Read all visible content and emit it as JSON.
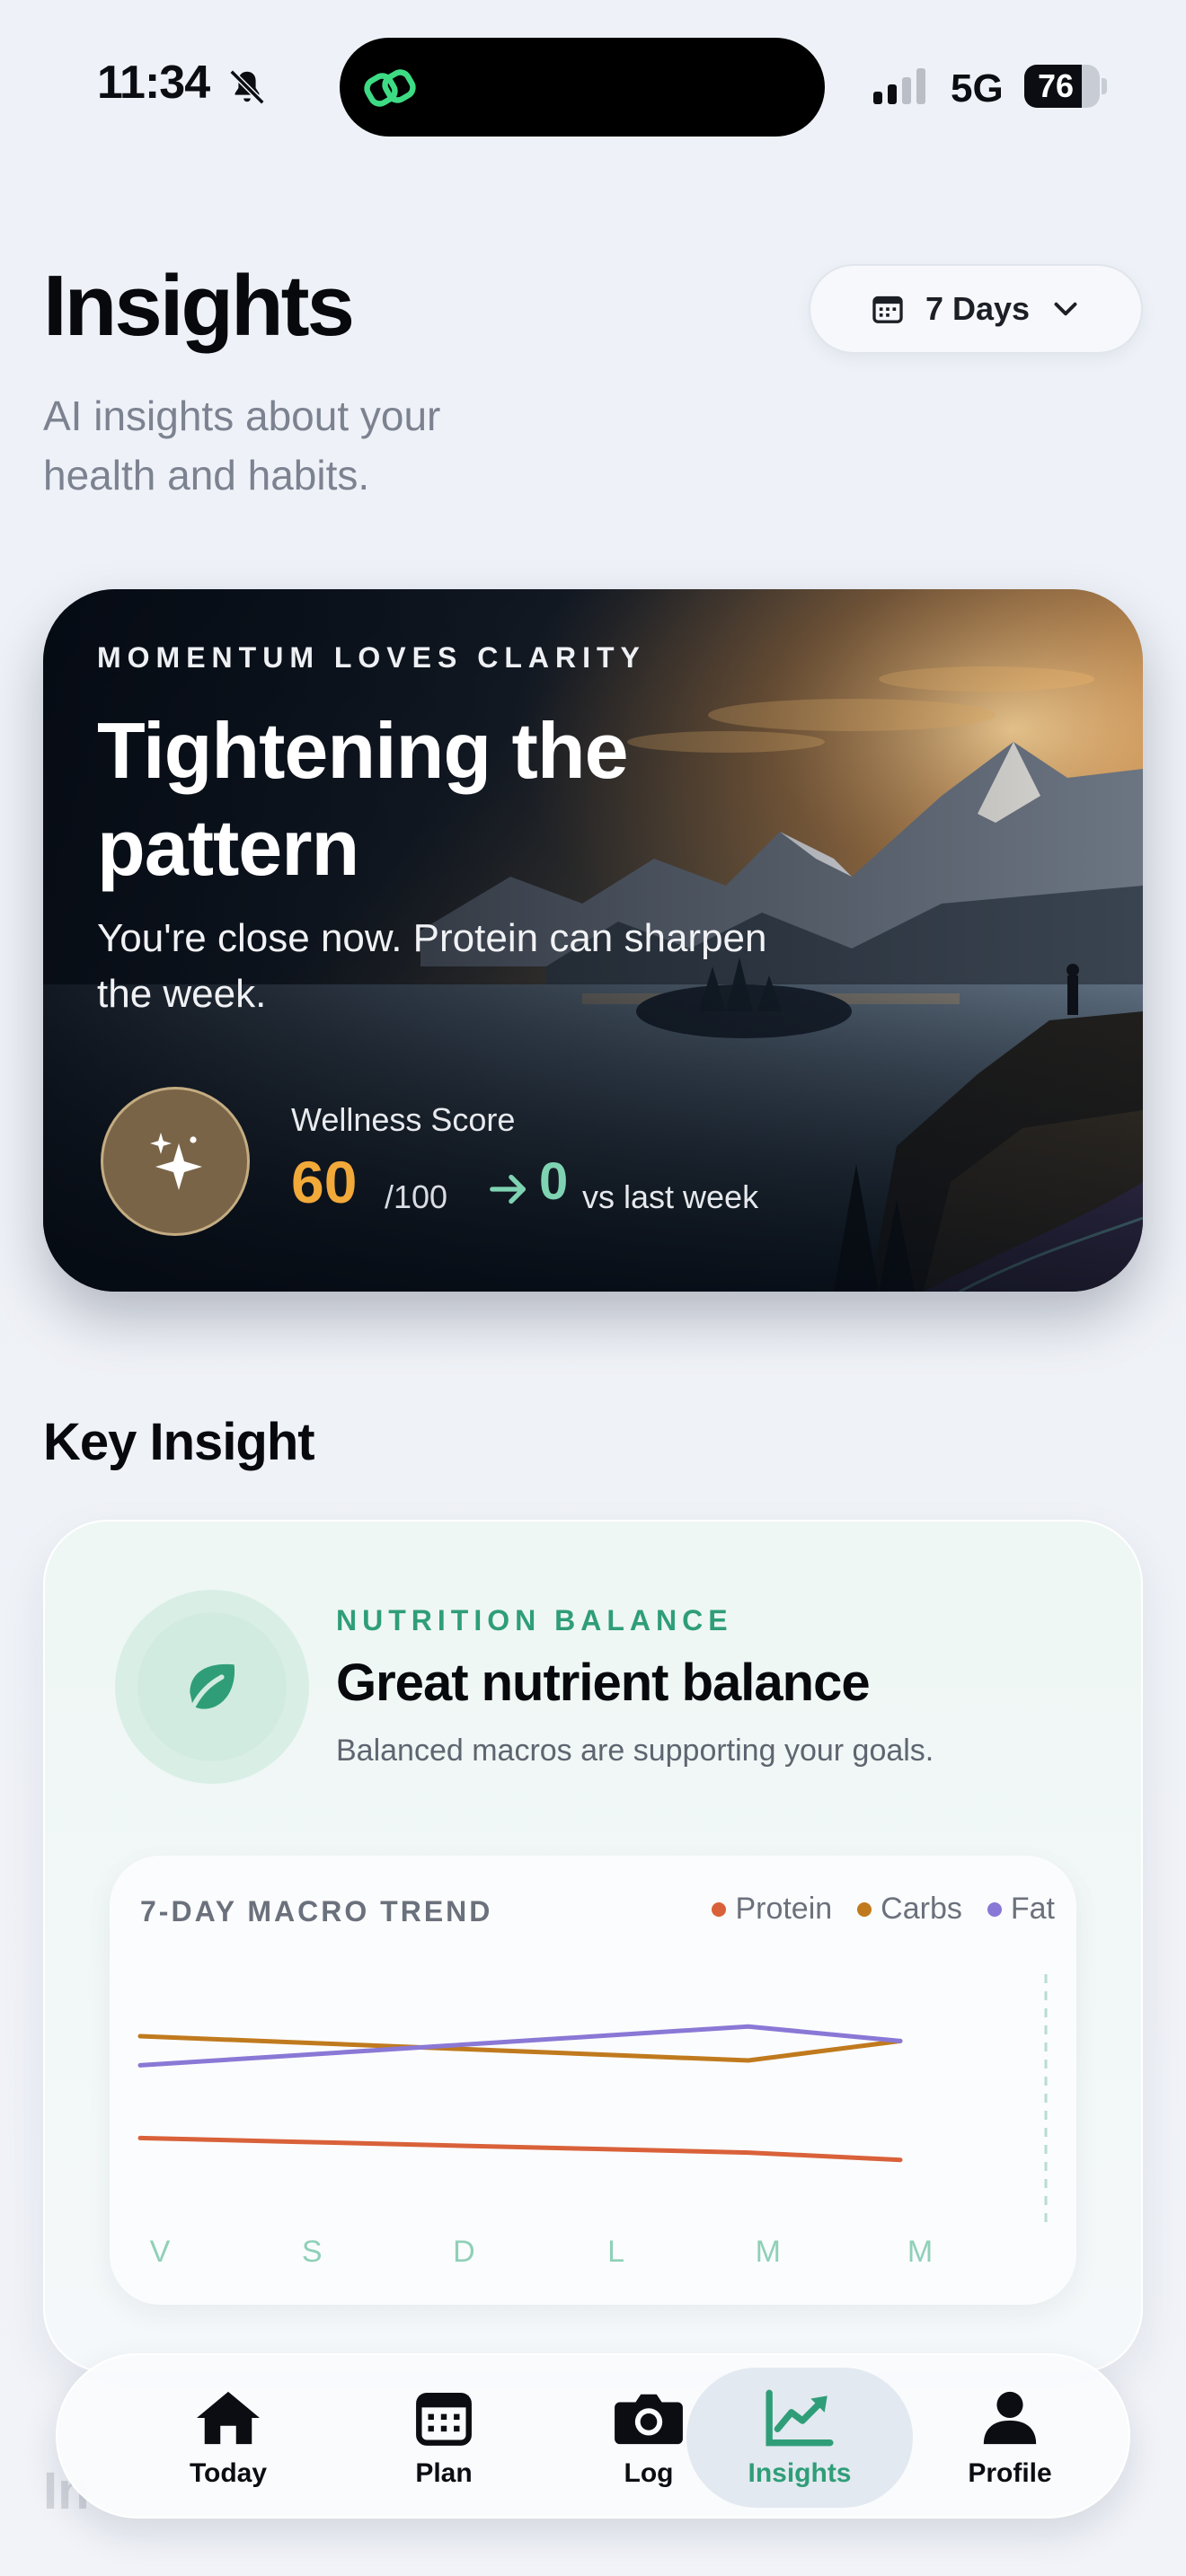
{
  "status_bar": {
    "time": "11:34",
    "network": "5G",
    "battery": "76",
    "battery_level": 0.76,
    "icons": [
      "bell-slash-icon",
      "link-icon",
      "signal-icon",
      "battery-icon"
    ]
  },
  "header": {
    "title": "Insights",
    "subtitle": "AI insights about your health and habits.",
    "range_select": {
      "label": "7 Days",
      "icons": [
        "calendar-icon",
        "chevron-down-icon"
      ]
    }
  },
  "hero": {
    "eyebrow": "MOMENTUM LOVES CLARITY",
    "title": "Tightening the pattern",
    "text": "You're close now. Protein can sharpen the week.",
    "badge_icon": "sparkles-icon",
    "score_label": "Wellness Score",
    "score_value": "60",
    "score_max": "/100",
    "delta_value": "0",
    "delta_label": "vs last week",
    "colors": {
      "score": "#f1a93a",
      "delta": "#7fd3b2"
    }
  },
  "key_insight": {
    "section_title": "Key Insight",
    "eyebrow": "NUTRITION BALANCE",
    "title": "Great nutrient balance",
    "description": "Balanced macros are supporting your goals.",
    "icon": "leaf-icon",
    "accent": "#2f9e78"
  },
  "chart_data": {
    "type": "line",
    "title": "7-DAY MACRO TREND",
    "categories": [
      "V",
      "S",
      "D",
      "L",
      "M",
      "M"
    ],
    "series": [
      {
        "name": "Protein",
        "color": "#d9613a",
        "values": [
          28,
          26.5,
          25,
          23.5,
          22,
          19
        ]
      },
      {
        "name": "Carbs",
        "color": "#c07a1e",
        "values": [
          70,
          67.5,
          65,
          62.5,
          60,
          68
        ]
      },
      {
        "name": "Fat",
        "color": "#8a78d6",
        "values": [
          58,
          62,
          66,
          70,
          74,
          68
        ]
      }
    ],
    "ylim": [
      0,
      100
    ],
    "grid": false,
    "legend": "top-right"
  },
  "tab_bar": {
    "faded_label": "In",
    "tabs": [
      {
        "label": "Today",
        "icon": "home-icon",
        "active": false
      },
      {
        "label": "Plan",
        "icon": "calendar-icon",
        "active": false
      },
      {
        "label": "Log",
        "icon": "camera-icon",
        "active": false
      },
      {
        "label": "Insights",
        "icon": "chart-trend-icon",
        "active": true
      },
      {
        "label": "Profile",
        "icon": "person-icon",
        "active": false
      }
    ],
    "active_color": "#2f9e78"
  }
}
